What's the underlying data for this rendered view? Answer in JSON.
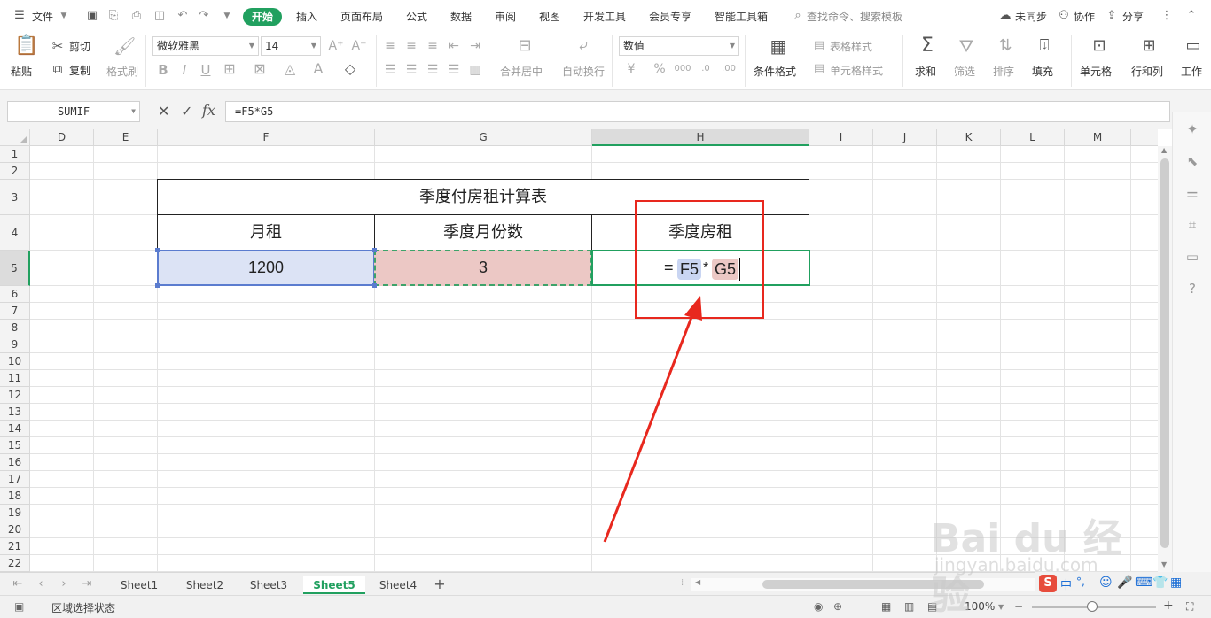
{
  "menubar": {
    "file": "文件",
    "tabs": [
      "开始",
      "插入",
      "页面布局",
      "公式",
      "数据",
      "审阅",
      "视图",
      "开发工具",
      "会员专享",
      "智能工具箱"
    ],
    "active_tab": "开始",
    "search_placeholder": "查找命令、搜索模板",
    "sync": "未同步",
    "collab": "协作",
    "share": "分享"
  },
  "ribbon": {
    "paste": "粘贴",
    "cut": "剪切",
    "copy": "复制",
    "format_painter": "格式刷",
    "font_name": "微软雅黑",
    "font_size": "14",
    "merge_center": "合并居中",
    "wrap_text": "自动换行",
    "number_format": "数值",
    "conditional_format": "条件格式",
    "table_style": "表格样式",
    "cell_style": "单元格样式",
    "sum": "求和",
    "filter": "筛选",
    "sort": "排序",
    "fill": "填充",
    "cell": "单元格",
    "row_col": "行和列",
    "worksheet": "工作"
  },
  "formula_bar": {
    "name_box": "SUMIF",
    "formula": "=F5*G5"
  },
  "columns": [
    "D",
    "E",
    "F",
    "G",
    "H",
    "I",
    "J",
    "K",
    "L",
    "M"
  ],
  "rows": [
    "1",
    "2",
    "3",
    "4",
    "5",
    "6",
    "7",
    "8",
    "9",
    "10",
    "11",
    "12",
    "13",
    "14",
    "15",
    "16",
    "17",
    "18",
    "19",
    "20",
    "21",
    "22"
  ],
  "table": {
    "title": "季度付房租计算表",
    "headers": [
      "月租",
      "季度月份数",
      "季度房租"
    ],
    "values": [
      "1200",
      "3"
    ],
    "formula_eq": "=",
    "formula_ref1": "F5",
    "formula_op": "*",
    "formula_ref2": "G5"
  },
  "sheets": [
    "Sheet1",
    "Sheet2",
    "Sheet3",
    "Sheet5",
    "Sheet4"
  ],
  "active_sheet": "Sheet5",
  "status": {
    "mode": "区域选择状态",
    "zoom": "100%"
  },
  "colors": {
    "accent": "#21a05f",
    "f5_fill": "#dce3f5",
    "g5_fill": "#ecc8c5",
    "annotation": "#e8281e"
  }
}
